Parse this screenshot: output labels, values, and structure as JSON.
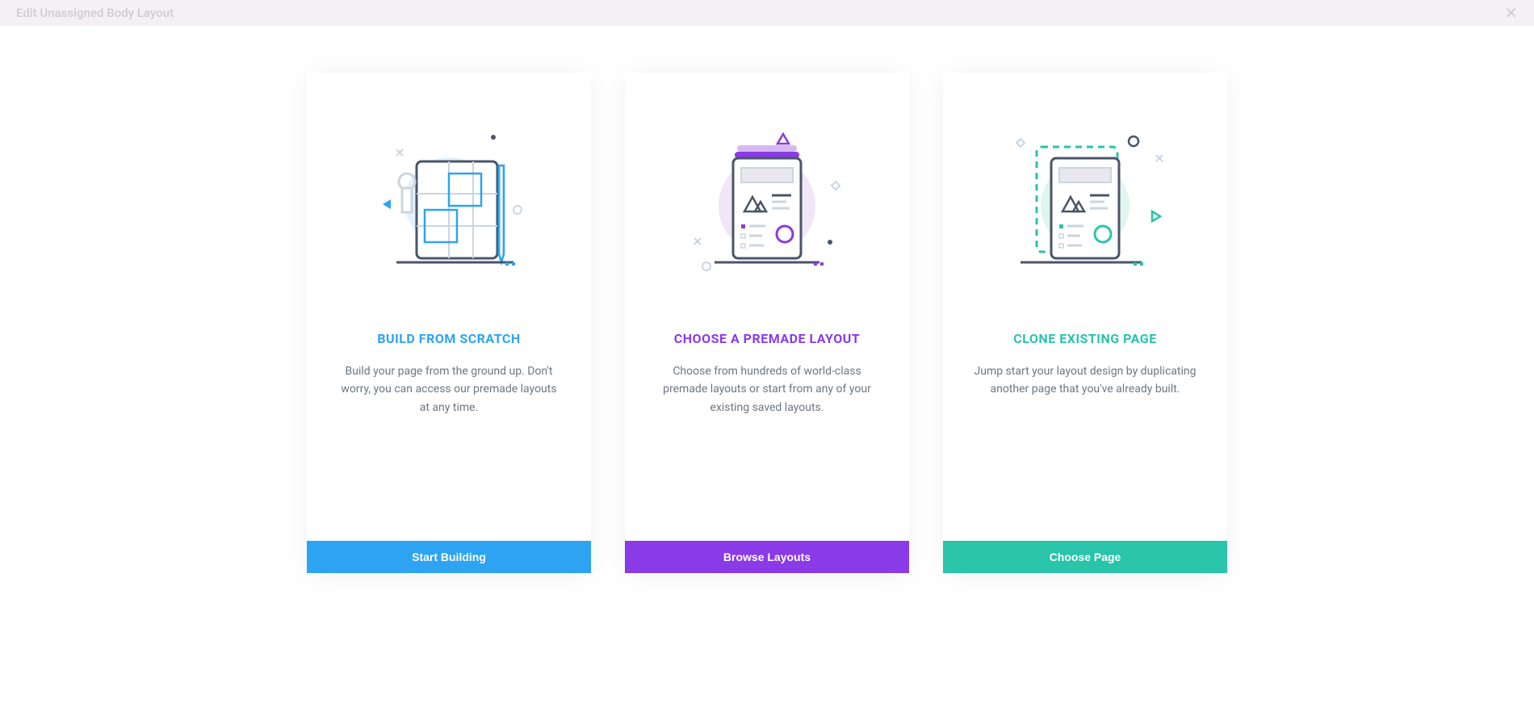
{
  "header": {
    "title": "Edit Unassigned Body Layout"
  },
  "cards": {
    "build": {
      "title": "BUILD FROM SCRATCH",
      "description": "Build your page from the ground up. Don't worry, you can access our premade layouts at any time.",
      "button": "Start Building"
    },
    "premade": {
      "title": "CHOOSE A PREMADE LAYOUT",
      "description": "Choose from hundreds of world-class premade layouts or start from any of your existing saved layouts.",
      "button": "Browse Layouts"
    },
    "clone": {
      "title": "CLONE EXISTING PAGE",
      "description": "Jump start your layout design by duplicating another page that you've already built.",
      "button": "Choose Page"
    }
  }
}
